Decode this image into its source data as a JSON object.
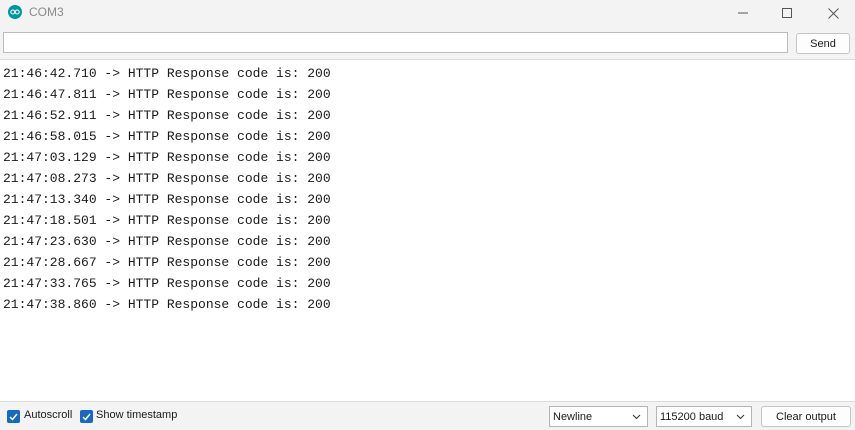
{
  "window": {
    "title": "COM3",
    "icon": "arduino-logo-icon"
  },
  "sendbar": {
    "input_value": "",
    "send_label": "Send"
  },
  "output": {
    "lines": [
      "21:46:42.710 -> HTTP Response code is: 200",
      "21:46:47.811 -> HTTP Response code is: 200",
      "21:46:52.911 -> HTTP Response code is: 200",
      "21:46:58.015 -> HTTP Response code is: 200",
      "21:47:03.129 -> HTTP Response code is: 200",
      "21:47:08.273 -> HTTP Response code is: 200",
      "21:47:13.340 -> HTTP Response code is: 200",
      "21:47:18.501 -> HTTP Response code is: 200",
      "21:47:23.630 -> HTTP Response code is: 200",
      "21:47:28.667 -> HTTP Response code is: 200",
      "21:47:33.765 -> HTTP Response code is: 200",
      "21:47:38.860 -> HTTP Response code is: 200"
    ]
  },
  "bottombar": {
    "autoscroll": {
      "label": "Autoscroll",
      "checked": true
    },
    "show_timestamp": {
      "label": "Show timestamp",
      "checked": true
    },
    "line_ending": "Newline",
    "baud_rate": "115200 baud",
    "clear_label": "Clear output"
  },
  "colors": {
    "accent": "#1767c4",
    "brand": "#00979c",
    "chrome": "#f3f3f3"
  }
}
